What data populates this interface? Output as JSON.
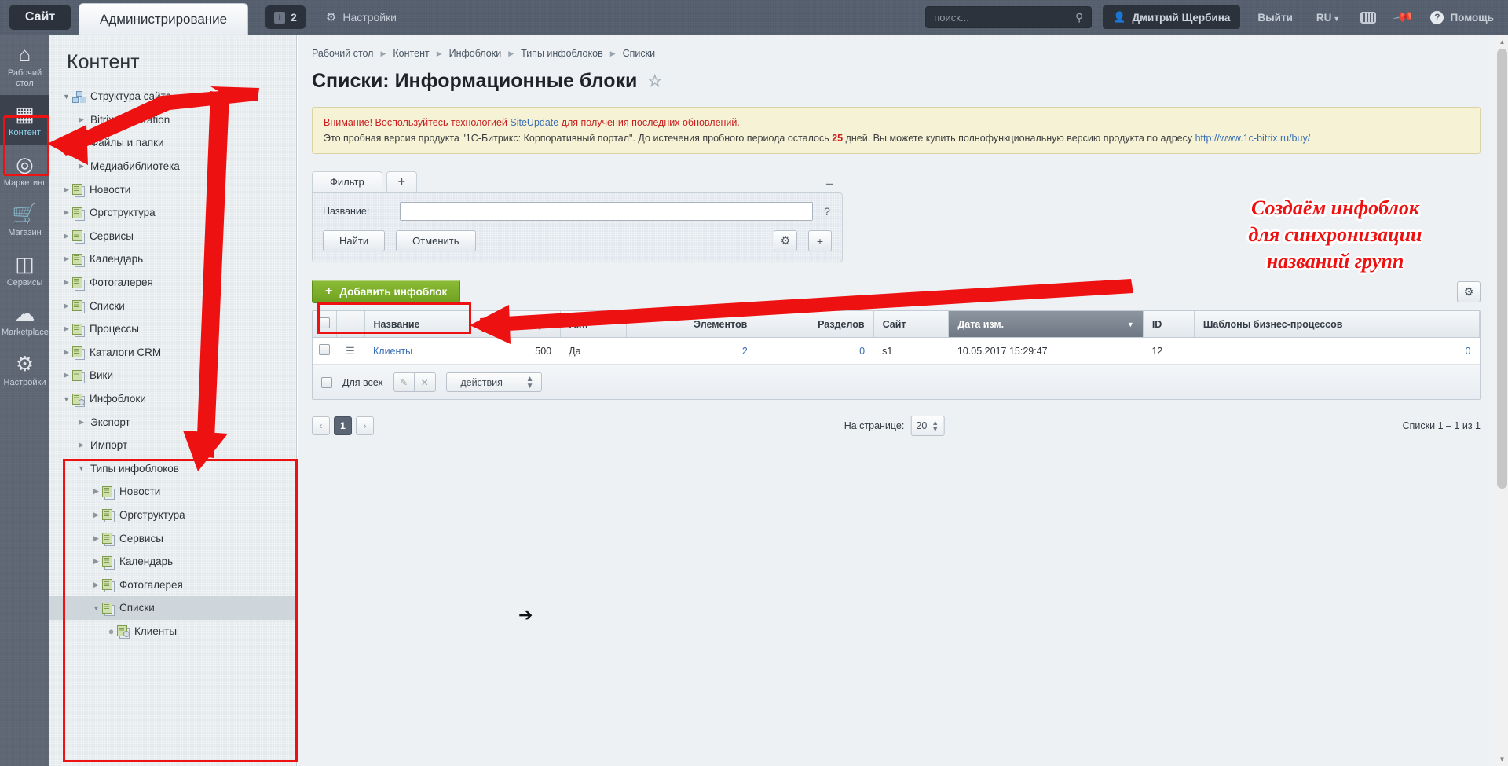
{
  "header": {
    "tab_site": "Сайт",
    "tab_admin": "Администрирование",
    "info_count": "2",
    "info_icon": "info-icon",
    "settings_label": "Настройки",
    "settings_icon": "gear-icon",
    "search_placeholder": "поиск...",
    "search_value": "",
    "search_icon": "search-icon",
    "user_name": "Дмитрий Щербина",
    "user_icon": "user-icon",
    "logout_label": "Выйти",
    "lang_label": "RU",
    "keyboard_icon": "keyboard-icon",
    "pin_icon": "pin-icon",
    "help_label": "Помощь",
    "help_icon": "question-circle-icon"
  },
  "rail": {
    "items": [
      {
        "label": "Рабочий стол",
        "icon": "home-icon",
        "active": false
      },
      {
        "label": "Контент",
        "icon": "document-icon",
        "active": true
      },
      {
        "label": "Маркетинг",
        "icon": "target-icon",
        "active": false
      },
      {
        "label": "Магазин",
        "icon": "basket-icon",
        "active": false
      },
      {
        "label": "Сервисы",
        "icon": "layers-icon",
        "active": false
      },
      {
        "label": "Marketplace",
        "icon": "cloud-download-icon",
        "active": false
      },
      {
        "label": "Настройки",
        "icon": "gear-icon",
        "active": false
      }
    ]
  },
  "tree": {
    "title": "Контент",
    "nodes": [
      {
        "label": "Структура сайта",
        "indent": 0,
        "twisty": "open",
        "icon": "sitemap-icon",
        "selected": false
      },
      {
        "label": "Bitrix corporation",
        "indent": 1,
        "twisty": "closed",
        "icon": "none",
        "selected": false
      },
      {
        "label": "Файлы и папки",
        "indent": 1,
        "twisty": "closed",
        "icon": "none",
        "selected": false
      },
      {
        "label": "Медиабиблиотека",
        "indent": 1,
        "twisty": "closed",
        "icon": "none",
        "selected": false
      },
      {
        "label": "Новости",
        "indent": 0,
        "twisty": "closed",
        "icon": "infoblock-icon",
        "selected": false
      },
      {
        "label": "Оргструктура",
        "indent": 0,
        "twisty": "closed",
        "icon": "infoblock-icon",
        "selected": false
      },
      {
        "label": "Сервисы",
        "indent": 0,
        "twisty": "closed",
        "icon": "infoblock-icon",
        "selected": false
      },
      {
        "label": "Календарь",
        "indent": 0,
        "twisty": "closed",
        "icon": "infoblock-icon",
        "selected": false
      },
      {
        "label": "Фотогалерея",
        "indent": 0,
        "twisty": "closed",
        "icon": "infoblock-icon",
        "selected": false
      },
      {
        "label": "Списки",
        "indent": 0,
        "twisty": "closed",
        "icon": "infoblock-icon",
        "selected": false
      },
      {
        "label": "Процессы",
        "indent": 0,
        "twisty": "closed",
        "icon": "infoblock-icon",
        "selected": false
      },
      {
        "label": "Каталоги CRM",
        "indent": 0,
        "twisty": "closed",
        "icon": "infoblock-icon",
        "selected": false
      },
      {
        "label": "Вики",
        "indent": 0,
        "twisty": "closed",
        "icon": "infoblock-icon",
        "selected": false
      },
      {
        "label": "Инфоблоки",
        "indent": 0,
        "twisty": "open",
        "icon": "infoblock-gear-icon",
        "selected": false
      },
      {
        "label": "Экспорт",
        "indent": 1,
        "twisty": "closed",
        "icon": "none",
        "selected": false
      },
      {
        "label": "Импорт",
        "indent": 1,
        "twisty": "closed",
        "icon": "none",
        "selected": false
      },
      {
        "label": "Типы инфоблоков",
        "indent": 1,
        "twisty": "open",
        "icon": "none",
        "selected": false
      },
      {
        "label": "Новости",
        "indent": 2,
        "twisty": "closed",
        "icon": "infoblock-icon",
        "selected": false
      },
      {
        "label": "Оргструктура",
        "indent": 2,
        "twisty": "closed",
        "icon": "infoblock-icon",
        "selected": false
      },
      {
        "label": "Сервисы",
        "indent": 2,
        "twisty": "closed",
        "icon": "infoblock-icon",
        "selected": false
      },
      {
        "label": "Календарь",
        "indent": 2,
        "twisty": "closed",
        "icon": "infoblock-icon",
        "selected": false
      },
      {
        "label": "Фотогалерея",
        "indent": 2,
        "twisty": "closed",
        "icon": "infoblock-icon",
        "selected": false
      },
      {
        "label": "Списки",
        "indent": 2,
        "twisty": "open",
        "icon": "infoblock-icon",
        "selected": true
      },
      {
        "label": "Клиенты",
        "indent": 3,
        "twisty": "dot",
        "icon": "infoblock-gear-icon",
        "selected": false
      }
    ]
  },
  "main": {
    "breadcrumb": [
      "Рабочий стол",
      "Контент",
      "Инфоблоки",
      "Типы инфоблоков",
      "Списки"
    ],
    "page_title": "Списки: Информационные блоки",
    "favorite_icon": "star-icon",
    "notice": {
      "line1_pre": "Внимание! Воспользуйтесь технологией ",
      "line1_link": "SiteUpdate",
      "line1_post": " для получения последних обновлений.",
      "line2_pre": "Это пробная версия продукта \"1С-Битрикс: Корпоративный портал\". До истечения пробного периода осталось ",
      "line2_days": "25",
      "line2_mid": " дней. Вы можете купить полнофункциональную версию продукта по адресу ",
      "line2_link": "http://www.1c-bitrix.ru/buy/"
    },
    "filter": {
      "tab_label": "Фильтр",
      "add_tab_icon": "plus-icon",
      "collapse_icon": "minus-icon",
      "name_label": "Название:",
      "name_value": "",
      "help_icon": "question-icon",
      "find_label": "Найти",
      "cancel_label": "Отменить",
      "settings_icon": "gear-icon",
      "add_icon": "plus-icon"
    },
    "toolbar": {
      "add_infoblock_label": "Добавить инфоблок",
      "add_icon": "plus-icon",
      "grid_settings_icon": "gear-icon"
    },
    "grid": {
      "columns": [
        "Название",
        "Сорт.",
        "Акт.",
        "Элементов",
        "Разделов",
        "Сайт",
        "Дата изм.",
        "ID",
        "Шаблоны бизнес-процессов"
      ],
      "sorted_column": "Дата изм.",
      "sort_direction": "▼",
      "rows": [
        {
          "name": "Клиенты",
          "sort": "500",
          "active": "Да",
          "elements": "2",
          "sections": "0",
          "site": "s1",
          "date_modified": "10.05.2017 15:29:47",
          "id": "12",
          "bp_templates": "0"
        }
      ],
      "footer": {
        "select_all_label": "Для всех",
        "edit_icon": "pencil-icon",
        "delete_icon": "close-icon",
        "action_select": "- действия -"
      }
    },
    "pager": {
      "prev_icon": "chevron-left-icon",
      "current_page": "1",
      "next_icon": "chevron-right-icon",
      "per_page_label": "На странице:",
      "per_page_value": "20",
      "total_label": "Списки 1 – 1 из 1"
    }
  },
  "annotation": {
    "text_line1": "Создаём инфоблок",
    "text_line2": "для синхронизации",
    "text_line3": "названий групп",
    "color": "#ee1111"
  },
  "scrollbar": {
    "up_icon": "caret-up-icon",
    "down_icon": "caret-down-icon"
  }
}
